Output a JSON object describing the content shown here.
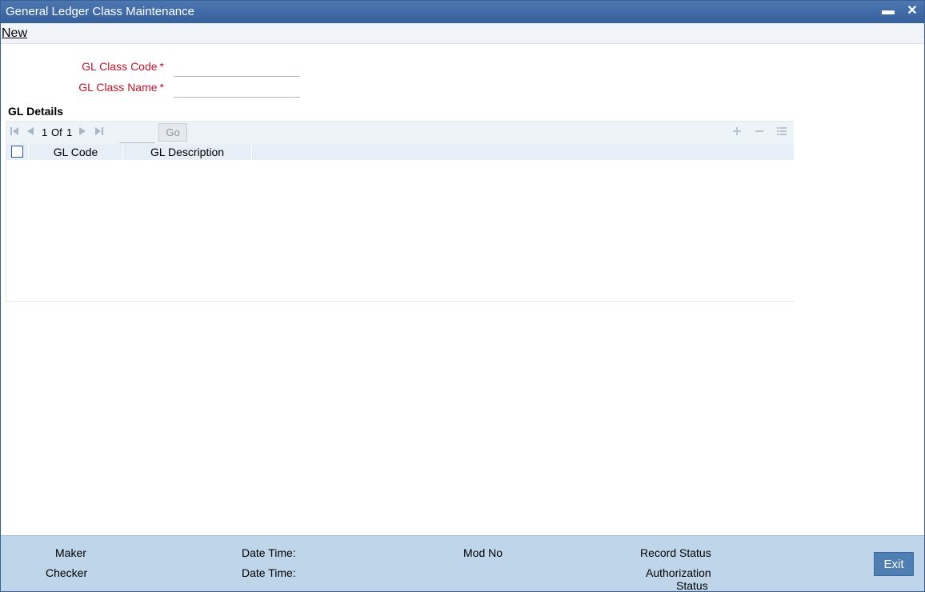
{
  "window": {
    "title": "General Ledger Class Maintenance",
    "minimize_glyph": "▬",
    "close_glyph": "✕"
  },
  "menu": {
    "new_label": "New"
  },
  "form": {
    "gl_class_code_label": "GL Class Code",
    "gl_class_code_value": "",
    "gl_class_name_label": "GL Class Name",
    "gl_class_name_value": "",
    "required_marker": "*"
  },
  "gl_details": {
    "section_title": "GL Details",
    "pager": {
      "current": "1",
      "of_label": "Of",
      "total": "1",
      "page_input_value": "",
      "go_label": "Go"
    },
    "columns": [
      "GL Code",
      "GL Description"
    ],
    "rows": []
  },
  "footer": {
    "maker_label": "Maker",
    "checker_label": "Checker",
    "date_time_label": "Date Time:",
    "mod_no_label": "Mod No",
    "record_status_label": "Record Status",
    "authorization_label": "Authorization",
    "status_label": "Status",
    "exit_label": "Exit"
  },
  "icons": {
    "first": "first-page-icon",
    "prev": "prev-page-icon",
    "next": "next-page-icon",
    "last": "last-page-icon",
    "add": "add-row-icon",
    "delete": "delete-row-icon",
    "details": "row-details-icon"
  },
  "colors": {
    "title_bar": "#36609c",
    "required_label": "#c0142a",
    "footer_bg": "#bfd5ea",
    "exit_button": "#4f7fb2"
  }
}
